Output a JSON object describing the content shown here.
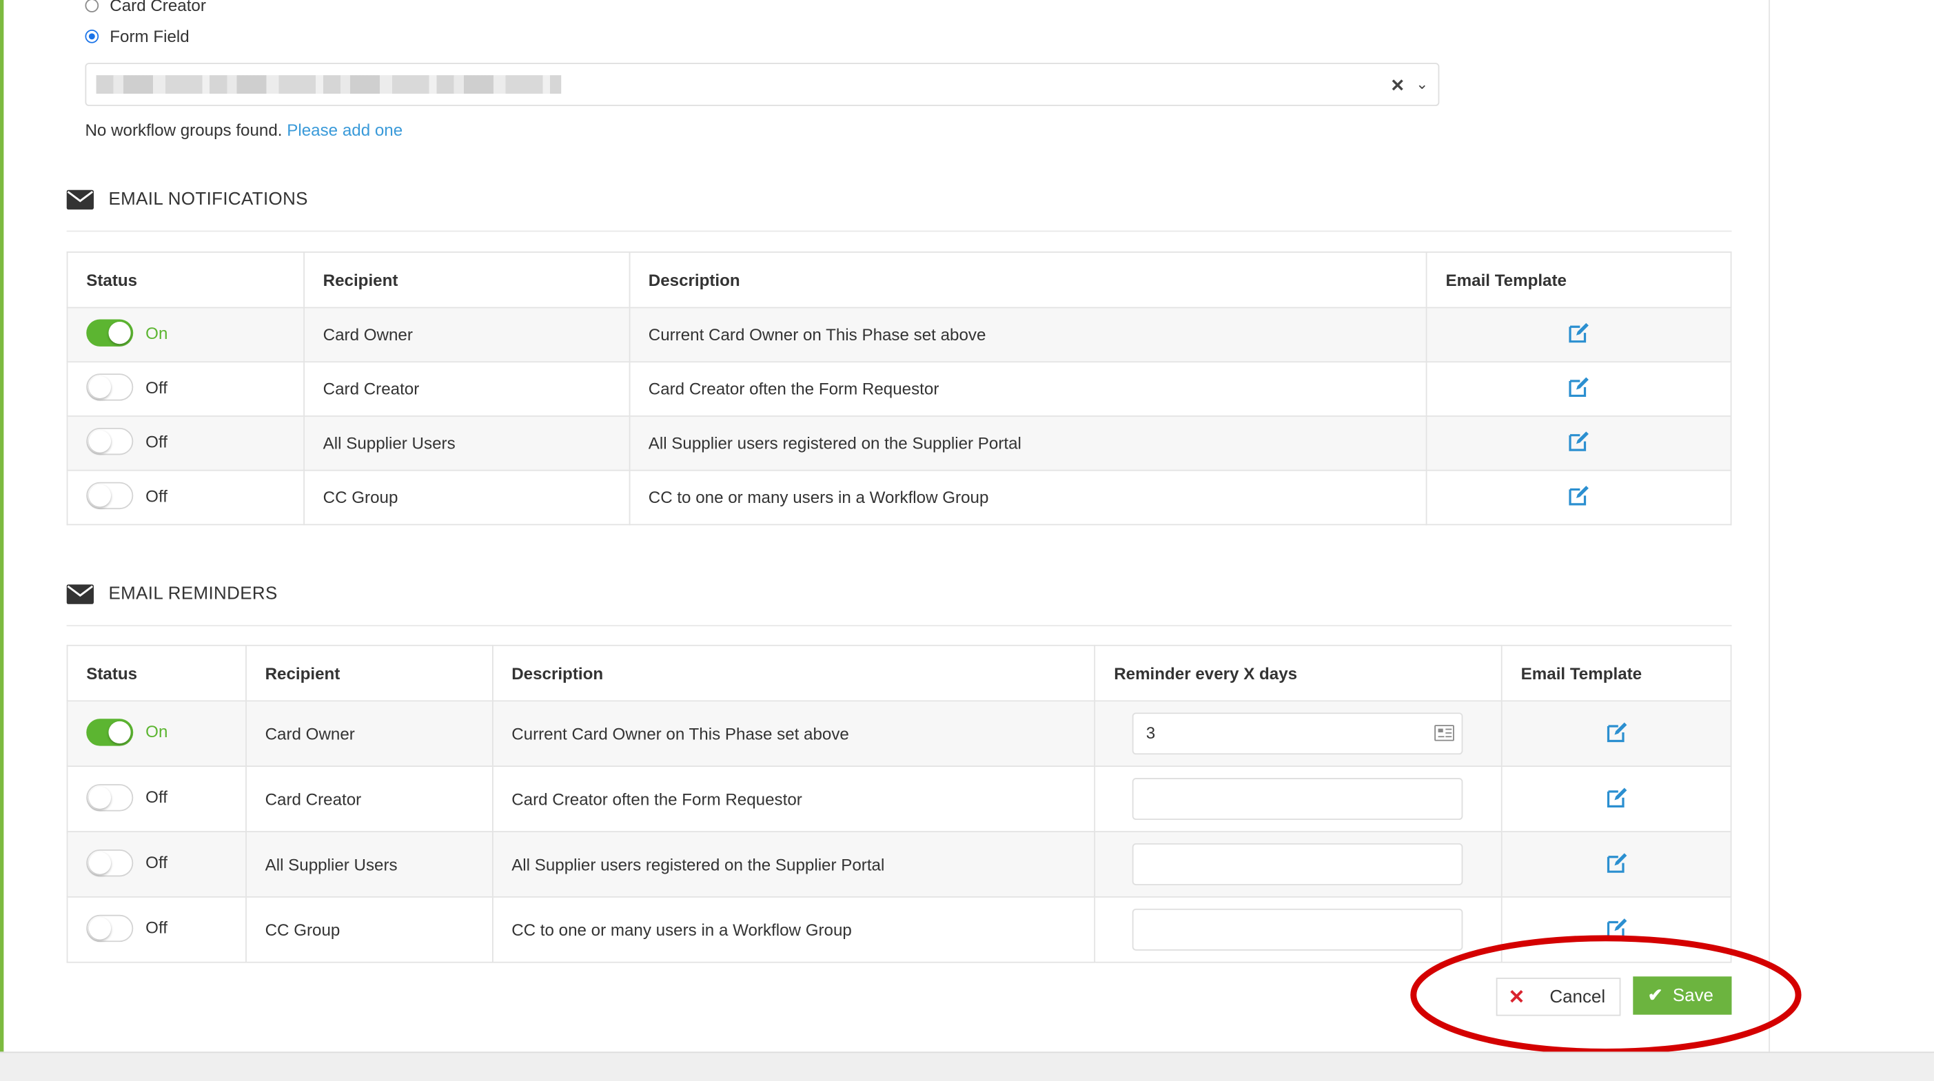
{
  "options": {
    "card_creator": "Card Creator",
    "form_field": "Form Field"
  },
  "form_field_select": {
    "clear_icon": "close-icon",
    "dropdown_icon": "chevron-down-icon"
  },
  "no_groups": {
    "text": "No workflow groups found.",
    "link": "Please add one"
  },
  "email_notifications": {
    "title": "EMAIL NOTIFICATIONS",
    "icon": "envelope-icon",
    "columns": [
      "Status",
      "Recipient",
      "Description",
      "Email Template"
    ],
    "rows": [
      {
        "status": "On",
        "recipient": "Card Owner",
        "description": "Current Card Owner on This Phase set above"
      },
      {
        "status": "Off",
        "recipient": "Card Creator",
        "description": "Card Creator often the Form Requestor"
      },
      {
        "status": "Off",
        "recipient": "All Supplier Users",
        "description": "All Supplier users registered on the Supplier Portal"
      },
      {
        "status": "Off",
        "recipient": "CC Group",
        "description": "CC to one or many users in a Workflow Group"
      }
    ]
  },
  "email_reminders": {
    "title": "EMAIL REMINDERS",
    "icon": "envelope-icon",
    "columns": [
      "Status",
      "Recipient",
      "Description",
      "Reminder every X days",
      "Email Template"
    ],
    "rows": [
      {
        "status": "On",
        "recipient": "Card Owner",
        "description": "Current Card Owner on This Phase set above",
        "days": "3"
      },
      {
        "status": "Off",
        "recipient": "Card Creator",
        "description": "Card Creator often the Form Requestor",
        "days": ""
      },
      {
        "status": "Off",
        "recipient": "All Supplier Users",
        "description": "All Supplier users registered on the Supplier Portal",
        "days": ""
      },
      {
        "status": "Off",
        "recipient": "CC Group",
        "description": "CC to one or many users in a Workflow Group",
        "days": ""
      }
    ]
  },
  "actions": {
    "cancel": "Cancel",
    "save": "Save"
  },
  "colors": {
    "accent_green": "#6cb43f",
    "toggle_on": "#5cb531",
    "link_blue": "#3a9ad9",
    "cancel_red": "#d9232e",
    "highlight_red": "#d40000"
  }
}
